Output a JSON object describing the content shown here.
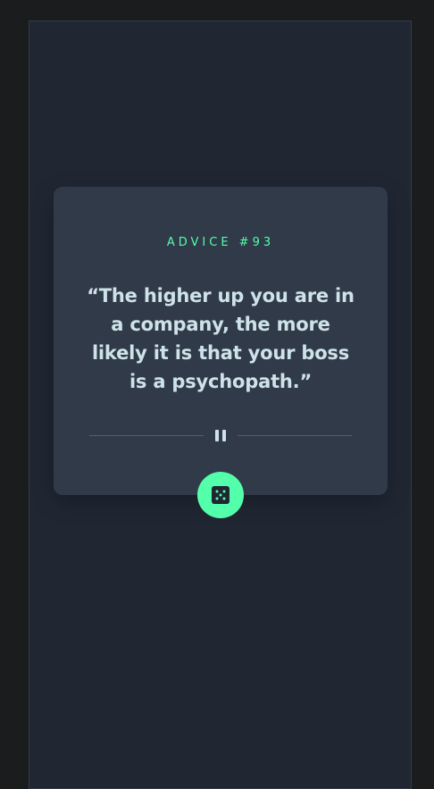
{
  "advice": {
    "label": "ADVICE #93",
    "quote": "“The higher up you are in a company, the more likely it is that your boss is a psychopath.”"
  },
  "icons": {
    "divider": "pause-icon",
    "button": "dice-icon"
  },
  "colors": {
    "accent": "#53ffaa",
    "card": "#313a48",
    "background": "#202733",
    "text": "#cee3e9",
    "divider": "#4f5d74"
  }
}
